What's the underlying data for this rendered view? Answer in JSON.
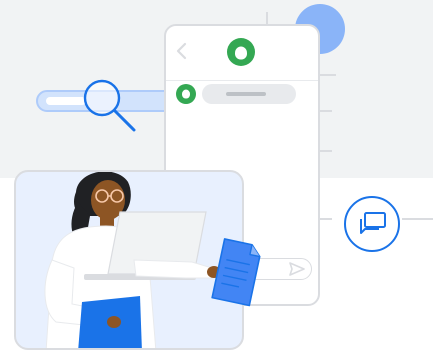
{
  "illustration": {
    "colors": {
      "background_band": "#f1f3f4",
      "accent_blue": "#1a73e8",
      "light_blue": "#8ab4f8",
      "avatar_green": "#34a853",
      "border_grey": "#dadce0"
    },
    "icons": [
      "chevron-left-icon",
      "account-avatar-icon",
      "send-icon",
      "feedback-chat-icon",
      "magnifier-icon",
      "document-icon"
    ]
  }
}
